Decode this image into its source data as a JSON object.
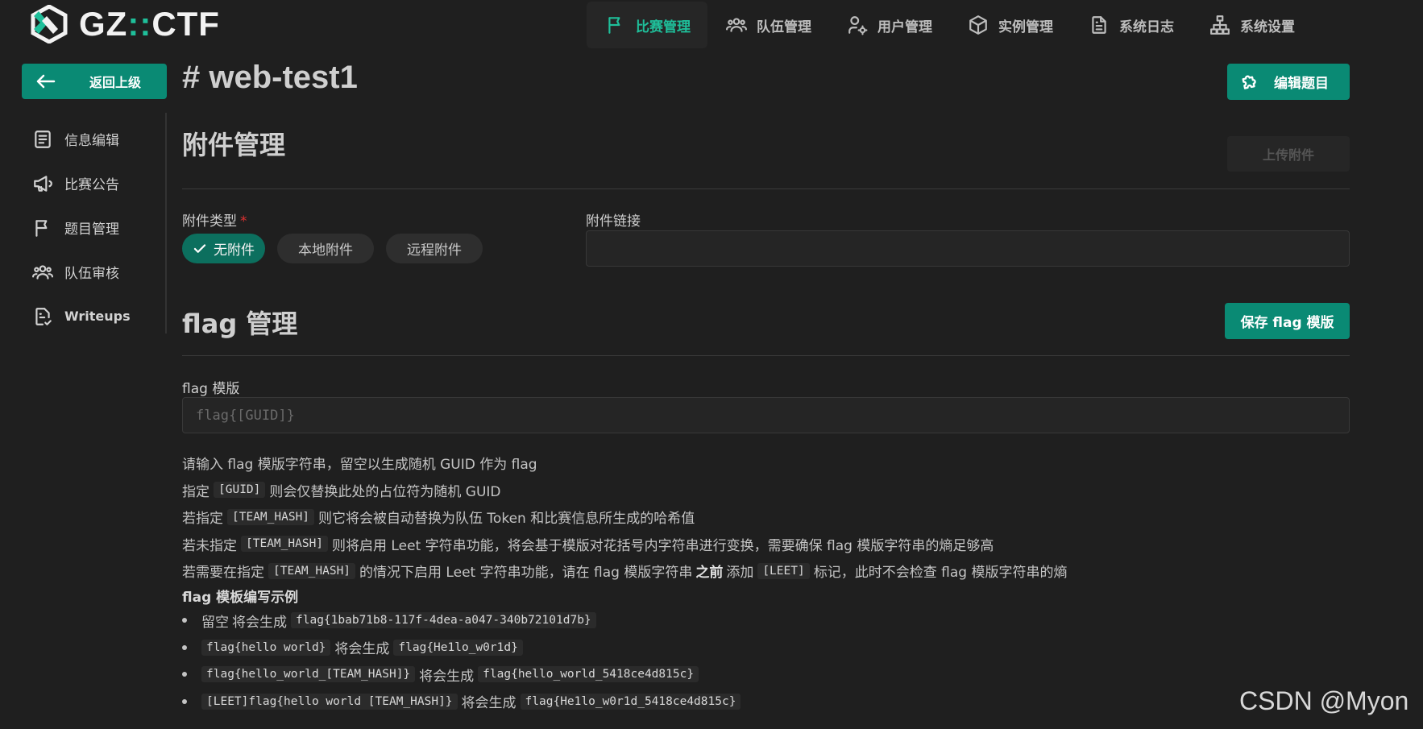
{
  "app": {
    "logo_text_a": "GZ",
    "logo_text_sep": "::",
    "logo_text_b": "CTF"
  },
  "nav": [
    {
      "label": "比赛管理",
      "icon": "flag-icon",
      "active": true
    },
    {
      "label": "队伍管理",
      "icon": "users-icon"
    },
    {
      "label": "用户管理",
      "icon": "user-gear-icon"
    },
    {
      "label": "实例管理",
      "icon": "box-icon"
    },
    {
      "label": "系统日志",
      "icon": "file-text-icon"
    },
    {
      "label": "系统设置",
      "icon": "sitemap-icon"
    }
  ],
  "sidebar": {
    "back_label": "返回上级",
    "items": [
      {
        "label": "信息编辑",
        "icon": "list-details-icon"
      },
      {
        "label": "比赛公告",
        "icon": "speakerphone-icon"
      },
      {
        "label": "题目管理",
        "icon": "flag-icon"
      },
      {
        "label": "队伍审核",
        "icon": "users-icon"
      },
      {
        "label": "Writeups",
        "icon": "file-check-icon"
      }
    ]
  },
  "main": {
    "title": "# web-test1",
    "edit_label": "编辑题目",
    "attachments": {
      "section_title": "附件管理",
      "upload_label": "上传附件",
      "type_label": "附件类型",
      "required_mark": "*",
      "types": [
        "无附件",
        "本地附件",
        "远程附件"
      ],
      "selected_type": "无附件",
      "link_label": "附件链接",
      "link_value": ""
    },
    "flag": {
      "section_title": "flag 管理",
      "save_label": "保存 flag 模版",
      "template_label": "flag 模版",
      "template_placeholder": "flag{[GUID]}",
      "help": {
        "l1": "请输入 flag 模版字符串，留空以生成随机 GUID 作为 flag",
        "l2_a": "指定",
        "l2_code": "[GUID]",
        "l2_b": "则会仅替换此处的占位符为随机 GUID",
        "l3_a": "若指定",
        "l3_code": "[TEAM_HASH]",
        "l3_b": "则它将会被自动替换为队伍 Token 和比赛信息所生成的哈希值",
        "l4_a": "若未指定",
        "l4_code": "[TEAM_HASH]",
        "l4_b": "则将启用 Leet 字符串功能，将会基于模版对花括号内字符串进行变换，需要确保 flag 模版字符串的熵足够高",
        "l5_a": "若需要在指定",
        "l5_code": "[TEAM_HASH]",
        "l5_b": "的情况下启用 Leet 字符串功能，请在 flag 模版字符串",
        "l5_bold": "之前",
        "l5_c": "添加",
        "l5_code2": "[LEET]",
        "l5_d": "标记，此时不会检查 flag 模版字符串的熵"
      },
      "examples_title": "flag 模板编写示例",
      "examples": [
        {
          "input_text": "留空",
          "input_is_code": false,
          "mid": "将会生成",
          "output": "flag{1bab71b8-117f-4dea-a047-340b72101d7b}"
        },
        {
          "input_text": "flag{hello world}",
          "input_is_code": true,
          "mid": "将会生成",
          "output": "flag{He1lo_w0r1d}"
        },
        {
          "input_text": "flag{hello_world_[TEAM_HASH]}",
          "input_is_code": true,
          "mid": "将会生成",
          "output": "flag{hello_world_5418ce4d815c}"
        },
        {
          "input_text": "[LEET]flag{hello world [TEAM_HASH]}",
          "input_is_code": true,
          "mid": "将会生成",
          "output": "flag{He1lo_w0r1d_5418ce4d815c}"
        }
      ]
    }
  },
  "watermark": "CSDN @Myon",
  "colors": {
    "accent": "#1fbf9a",
    "button": "#0a8a74",
    "background": "#1f1f1f",
    "required": "#e03131"
  }
}
